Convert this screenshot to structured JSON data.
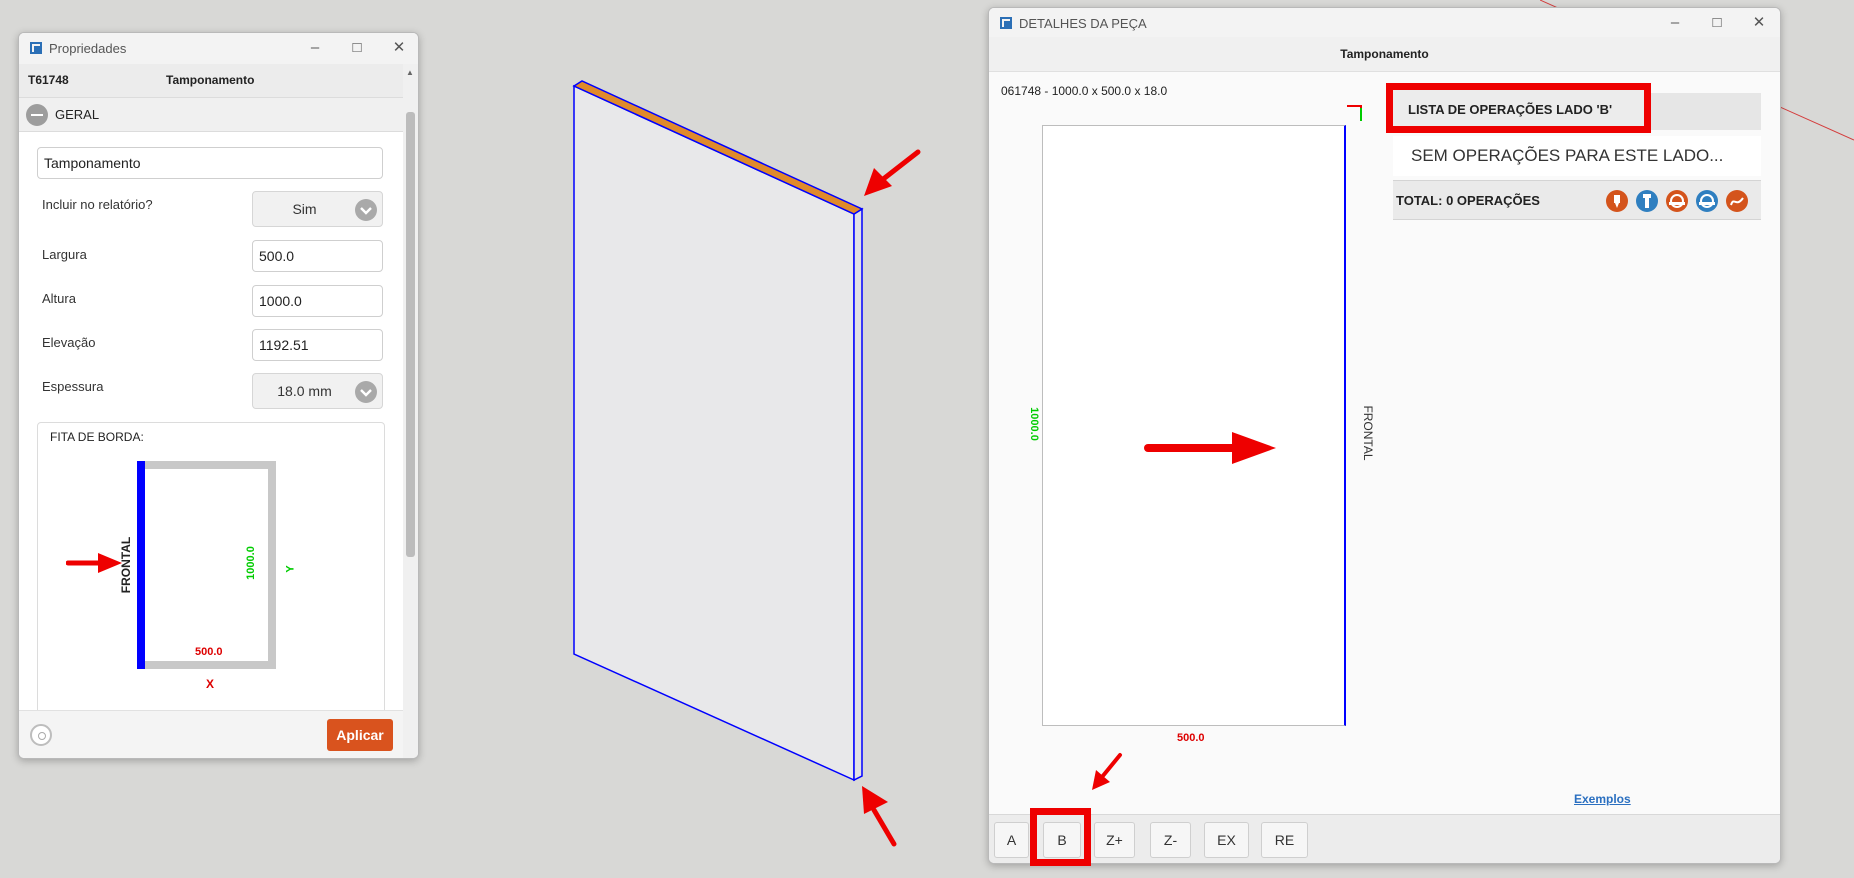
{
  "properties_window": {
    "title": "Propriedades",
    "code": "T61748",
    "name": "Tamponamento",
    "section": "GERAL",
    "name_value": "Tamponamento",
    "include_label": "Incluir no relatório?",
    "include_value": "Sim",
    "width_label": "Largura",
    "width_value": "500.0",
    "height_label": "Altura",
    "height_value": "1000.0",
    "elevation_label": "Elevação",
    "elevation_value": "1192.51",
    "thickness_label": "Espessura",
    "thickness_value": "18.0 mm",
    "edge_label": "FITA DE BORDA:",
    "edge_front": "FRONTAL",
    "edge_dim_y": "1000.0",
    "edge_axis_y": "Y",
    "edge_dim_x": "500.0",
    "edge_axis_x": "X",
    "apply_label": "Aplicar"
  },
  "details_window": {
    "title": "DETALHES DA PEÇA",
    "header": "Tamponamento",
    "dims": "061748 - 1000.0 x 500.0 x 18.0",
    "side_dim": "1000.0",
    "bottom_dim": "500.0",
    "front_label": "FRONTAL",
    "ops_title": "LISTA DE OPERAÇÕES LADO 'B'",
    "no_ops": "SEM OPERAÇÕES PARA ESTE LADO...",
    "total": "TOTAL: 0 OPERAÇÕES",
    "examples_link": "Exemplos",
    "side_buttons": [
      "A",
      "B",
      "Z+",
      "Z-",
      "EX",
      "RE"
    ]
  },
  "colors": {
    "accent_orange": "#d9531e",
    "edge_blue": "#0000ff",
    "dim_green": "#00cc00",
    "dim_red": "#dd0000",
    "highlight_red": "#ee0000"
  },
  "icons": [
    "app-icon",
    "minimize-icon",
    "maximize-icon",
    "close-icon",
    "collapse-icon",
    "chevron-down-icon",
    "eye-icon",
    "drill-icon",
    "screw-icon",
    "saw-icon",
    "blade-icon",
    "path-icon",
    "arrow-annotation-icon"
  ]
}
